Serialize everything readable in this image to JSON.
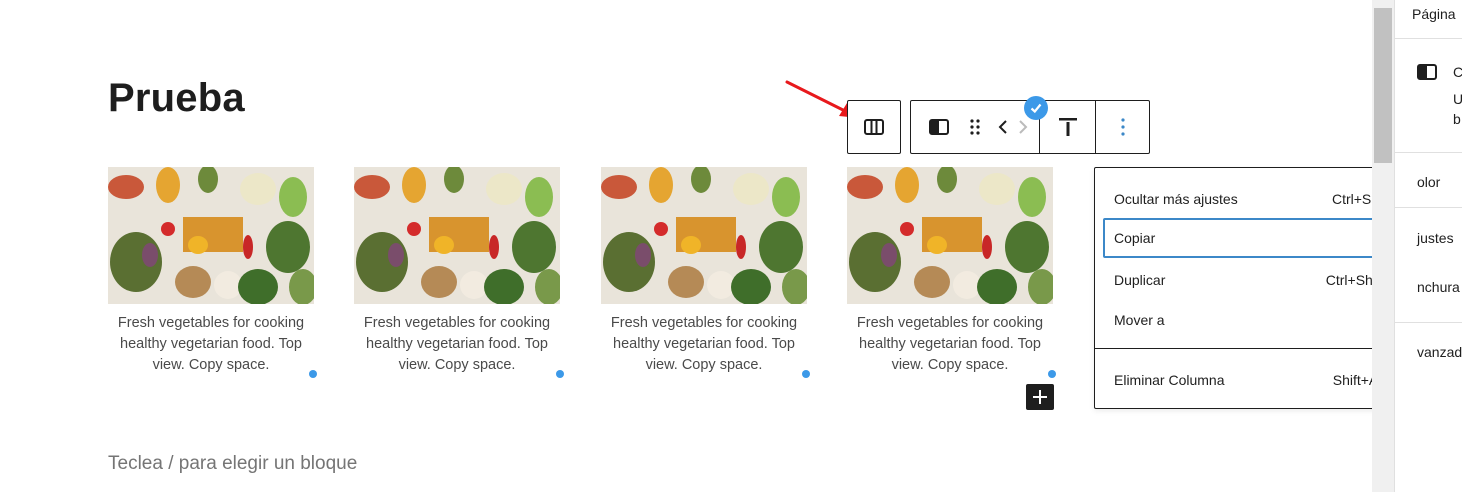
{
  "page": {
    "title": "Prueba",
    "placeholder": "Teclea / para elegir un bloque"
  },
  "gallery": [
    {
      "caption": "Fresh vegetables for cooking healthy vegetarian food. Top view. Copy space."
    },
    {
      "caption": "Fresh vegetables for cooking healthy vegetarian food. Top view. Copy space."
    },
    {
      "caption": "Fresh vegetables for cooking healthy vegetarian food. Top view. Copy space."
    },
    {
      "caption": "Fresh vegetables for cooking healthy vegetarian food. Top view. Copy space."
    }
  ],
  "toolbar": {
    "parent_icon": "columns-icon",
    "block_icon": "column-icon",
    "drag_icon": "drag-handle-icon",
    "move_left": "‹",
    "move_right": "›",
    "align_icon": "align-top-icon",
    "more_icon": "more-vertical-icon"
  },
  "menu": {
    "items": [
      {
        "label": "Ocultar más ajustes",
        "shortcut": "Ctrl+Shift+,"
      },
      {
        "label": "Copiar",
        "shortcut": ""
      },
      {
        "label": "Duplicar",
        "shortcut": "Ctrl+Shift+D"
      },
      {
        "label": "Mover a",
        "shortcut": ""
      },
      {
        "label": "Eliminar Columna",
        "shortcut": "Shift+Alt+Z"
      }
    ]
  },
  "sidebar": {
    "tab": "Página",
    "block_initial": "C",
    "desc_1": "U",
    "desc_2": "b",
    "color": "olor",
    "ajustes": "justes",
    "anchura": "nchura",
    "avanzado": "vanzad"
  },
  "colors": {
    "accent": "#3c99e8",
    "arrow": "#e8191c",
    "dark": "#1e1e1e"
  }
}
